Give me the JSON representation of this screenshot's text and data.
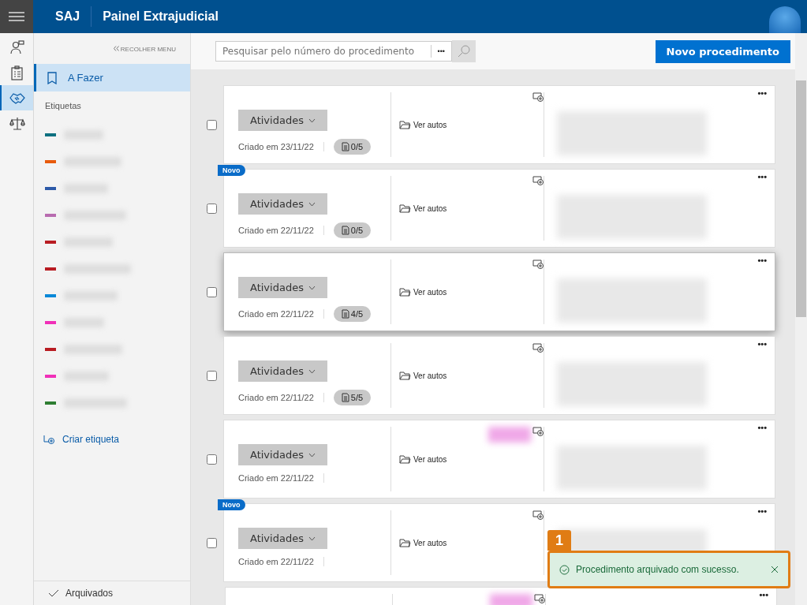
{
  "header": {
    "brand": "SAJ",
    "title": "Painel Extrajudicial"
  },
  "rail": [
    {
      "kind": "person",
      "selected": false
    },
    {
      "kind": "clipboard",
      "selected": false
    },
    {
      "kind": "handshake",
      "selected": true
    },
    {
      "kind": "scales",
      "selected": false
    }
  ],
  "sidebar": {
    "collapse": "RECOLHER MENU",
    "items": [
      {
        "label": "A Fazer",
        "selected": true
      }
    ],
    "tags_heading": "Etiquetas",
    "tags": [
      {
        "color": "#0e7080"
      },
      {
        "color": "#e85a0c"
      },
      {
        "color": "#2c5aa8"
      },
      {
        "color": "#b86cb0"
      },
      {
        "color": "#b81c22"
      },
      {
        "color": "#b81c22"
      },
      {
        "color": "#0a88d8"
      },
      {
        "color": "#f030b8"
      },
      {
        "color": "#b81c22"
      },
      {
        "color": "#f030b8"
      },
      {
        "color": "#2e7d32"
      }
    ],
    "create_tag": "Criar etiqueta",
    "archived": "Arquivados"
  },
  "toolbar": {
    "search": {
      "placeholder": "Pesquisar pelo número do procedimento"
    },
    "more": "•••",
    "new_button": "Novo procedimento"
  },
  "cards": [
    {
      "hovered": false,
      "checked": false,
      "activities": "Atividades",
      "created": "Criado em 23/11/22",
      "progress": "0/5",
      "label_blur": false,
      "open": "Ver autos",
      "more": "•••"
    },
    {
      "badge": "Novo",
      "hovered": false,
      "checked": false,
      "activities": "Atividades",
      "created": "Criado em 22/11/22",
      "progress": "0/5",
      "label_blur": false,
      "open": "Ver autos",
      "more": "•••"
    },
    {
      "hovered": true,
      "checked": false,
      "activities": "Atividades",
      "created": "Criado em 22/11/22",
      "progress": "4/5",
      "label_blur": false,
      "open": "Ver autos",
      "more": "•••"
    },
    {
      "hovered": false,
      "checked": false,
      "activities": "Atividades",
      "created": "Criado em 22/11/22",
      "progress": "5/5",
      "label_blur": false,
      "open": "Ver autos",
      "more": "•••"
    },
    {
      "hovered": false,
      "checked": false,
      "activities": "Atividades",
      "created": "Criado em 22/11/22",
      "label_blur": true,
      "open": "Ver autos",
      "more": "•••"
    },
    {
      "badge": "Novo",
      "hovered": false,
      "checked": false,
      "activities": "Atividades",
      "created": "Criado em 22/11/22",
      "label_blur": false,
      "open": "Ver autos",
      "more": "•••"
    },
    {
      "hovered": false,
      "label_blur": true,
      "more": "•••"
    }
  ],
  "toast": {
    "callout": "1",
    "message": "Procedimento arquivado com sucesso."
  }
}
